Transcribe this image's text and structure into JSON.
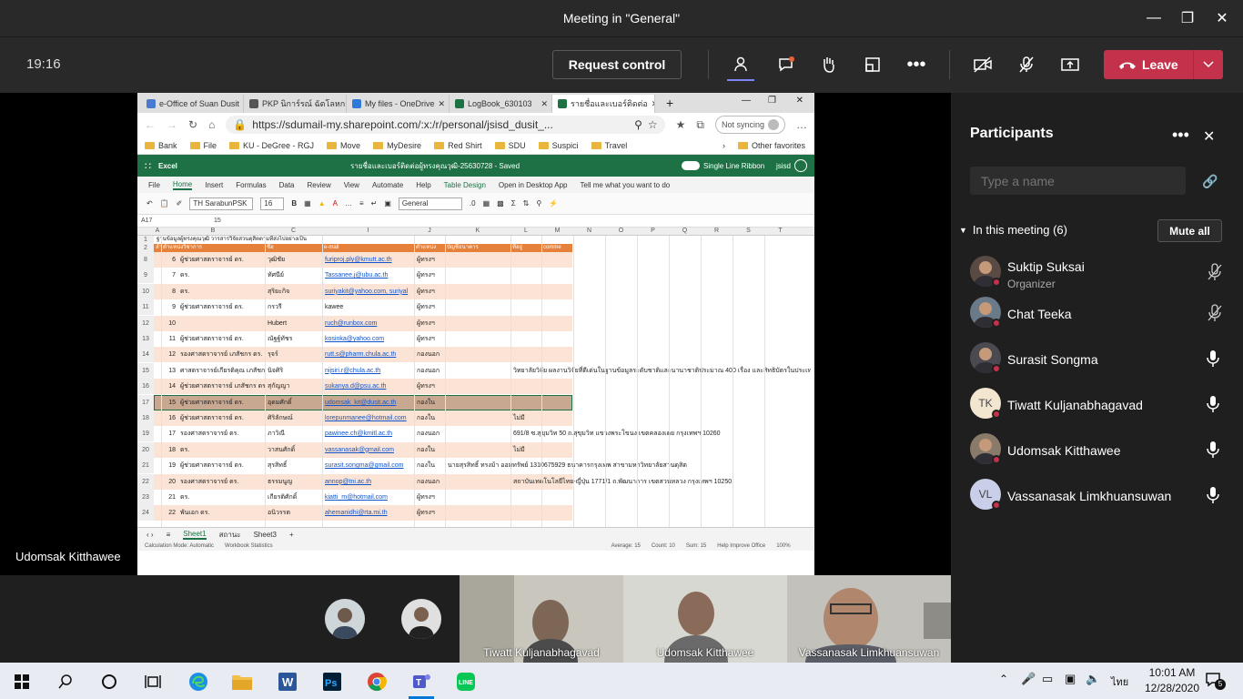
{
  "window": {
    "title": "Meeting in \"General\""
  },
  "toolbar": {
    "time": "19:16",
    "request_control": "Request control",
    "leave": "Leave"
  },
  "stage": {
    "presenter_name": "Udomsak Kitthawee"
  },
  "browser": {
    "tabs": [
      {
        "label": "e-Office of Suan Dusit",
        "color": "#4a7bd0"
      },
      {
        "label": "PKP นิการ์รณ์ ฉัตโลหกร",
        "color": "#555555"
      },
      {
        "label": "My files - OneDrive",
        "color": "#2f7ad8"
      },
      {
        "label": "LogBook_630103",
        "color": "#1e7145"
      },
      {
        "label": "รายชื่อและเบอร์ติดต่อ",
        "color": "#1e7145"
      }
    ],
    "url": "https://sdumail-my.sharepoint.com/:x:/r/personal/jsisd_dusit_...",
    "sync_label": "Not syncing",
    "favorites": [
      "Bank",
      "File",
      "KU - DeGree - RGJ",
      "Move",
      "MyDesire",
      "Red Shirt",
      "SDU",
      "Suspici",
      "Travel"
    ],
    "other_favorites": "Other favorites",
    "excel": {
      "app": "Excel",
      "doc_title": "รายชื่อและเบอร์ติดต่อผู้ทรงคุณวุฒิ-25630728 - Saved",
      "single_line": "Single Line Ribbon",
      "user": "jsisd",
      "ribbon_tabs": [
        "File",
        "Home",
        "Insert",
        "Formulas",
        "Data",
        "Review",
        "View",
        "Automate",
        "Help",
        "Table Design",
        "Open in Desktop App",
        "Tell me what you want to do"
      ],
      "font": "TH SarabunPSK",
      "font_size": "16",
      "number_format": "General",
      "cell_ref": "A17",
      "formula": "15",
      "columns": [
        "A",
        "B",
        "C",
        "I",
        "J",
        "K",
        "L",
        "M",
        "N",
        "O",
        "P",
        "Q",
        "R",
        "S",
        "T"
      ],
      "title_row": "ฐานข้อมูลผู้ทรงคุณวุฒิ วารสารวิจัยสวนดุสิตตามที่ส่งไปอย่างเป็น",
      "headers": [
        "ลำ",
        "ตำแหน่งวิชาการ",
        "ชื่อ",
        "e-mail",
        "ตำแหน่ง",
        "บัญชีธนาคาร",
        "ที่อยู่",
        "comme"
      ],
      "rows": [
        {
          "num": "8",
          "no": "6",
          "title": "ผู้ช่วยศาสตราจารย์ ดร.",
          "name": "วุฒิชัย",
          "email": "furiproj.ply@kmutt.ac.th",
          "pos": "ผู้ทรงฯ",
          "bank": "",
          "addr": ""
        },
        {
          "num": "9",
          "no": "7",
          "title": "ดร.",
          "name": "ทัศนีย์",
          "email": "Tassanee.j@ubu.ac.th",
          "pos": "ผู้ทรงฯ",
          "bank": "",
          "addr": ""
        },
        {
          "num": "10",
          "no": "8",
          "title": "ดร.",
          "name": "สุริยะกิจ",
          "email": "suriyakit@yahoo.com, suriyal",
          "pos": "ผู้ทรงฯ",
          "bank": "",
          "addr": ""
        },
        {
          "num": "11",
          "no": "9",
          "title": "ผู้ช่วยศาสตราจารย์ ดร.",
          "name": "กรวรี",
          "email": "kawee",
          "pos": "ผู้ทรงฯ",
          "bank": "",
          "addr": ""
        },
        {
          "num": "12",
          "no": "10",
          "title": "",
          "name": "Hubert",
          "email": "ruch@runbox.com",
          "pos": "ผู้ทรงฯ",
          "bank": "",
          "addr": ""
        },
        {
          "num": "13",
          "no": "11",
          "title": "ผู้ช่วยศาสตราจารย์ ดร.",
          "name": "ณัฐฐ์ทัชร",
          "email": "kosinka@yahoo.com",
          "pos": "ผู้ทรงฯ",
          "bank": "",
          "addr": ""
        },
        {
          "num": "14",
          "no": "12",
          "title": "รองศาสตราจารย์ เภสัชกร ดร.",
          "name": "รุจร์",
          "email": "rutt.s@pharm.chula.ac.th",
          "pos": "กองนอก",
          "bank": "",
          "addr": ""
        },
        {
          "num": "15",
          "no": "13",
          "title": "ศาสตราจารย์เกียรติคุณ เภสัชกร ดร.",
          "name": "นิจศิริ",
          "email": "nijsiri.r@chula.ac.th",
          "pos": "กองนอก",
          "bank": "",
          "addr": "วิทยาลัยวิจัย ผลงานวิจัยที่ดีเด่นในฐานข้อมูลระดับชาติและนานาชาติประมาณ 400 เรื่อง และสิทธิบัตรในประเท"
        },
        {
          "num": "16",
          "no": "14",
          "title": "ผู้ช่วยศาสตราจารย์ เภสัชกร ดร.",
          "name": "สุกัญญา",
          "email": "sukanya.d@psu.ac.th",
          "pos": "ผู้ทรงฯ",
          "bank": "",
          "addr": ""
        },
        {
          "num": "17",
          "no": "15",
          "title": "ผู้ช่วยศาสตราจารย์ ดร.",
          "name": "อุดมศักดิ์",
          "email": "udomsak_kit@dusit.ac.th",
          "pos": "กองใน",
          "bank": "",
          "addr": ""
        },
        {
          "num": "18",
          "no": "16",
          "title": "ผู้ช่วยศาสตราจารย์ ดร.",
          "name": "ศิริลักษณ์",
          "email": "lorepunmanee@hotmail.com",
          "pos": "กองใน",
          "bank": "",
          "addr": "ไม่มี"
        },
        {
          "num": "19",
          "no": "17",
          "title": "รองศาสตราจารย์ ดร.",
          "name": "ภาวิณี",
          "email": "pawinee.ch@kmitl.ac.th",
          "pos": "กองนอก",
          "bank": "",
          "addr": "691/8 ซ.สุขุมวิท 50 ถ.สุขุมวิท แขวงพระโขนง เขตคลองเตย กรุงเทพฯ 10260"
        },
        {
          "num": "20",
          "no": "18",
          "title": "ดร.",
          "name": "วาสนศักดิ์",
          "email": "vassanasak@gmail.com",
          "pos": "กองใน",
          "bank": "",
          "addr": "ไม่มี"
        },
        {
          "num": "21",
          "no": "19",
          "title": "ผู้ช่วยศาสตราจารย์ ดร.",
          "name": "สุรสิทธิ์",
          "email": "surasit.songma@gmail.com",
          "pos": "กองใน",
          "bank": "นายสุรสิทธิ์ ทรงม้า ออมทรัพย์ 1310675929 ธนาคารกรุงเทพ สาขามหาวิทยาลัยสวนดุสิต",
          "addr": ""
        },
        {
          "num": "22",
          "no": "20",
          "title": "รองศาสตราจารย์ ดร.",
          "name": "ธรรมนูญ",
          "email": "annop@tni.ac.th",
          "pos": "กองนอก",
          "bank": "",
          "addr": "สถาบันเทคโนโลยีไทย-ญี่ปุ่น 1771/1 ถ.พัฒนาการ เขตสวนหลวง กรุงเทพฯ 10250"
        },
        {
          "num": "23",
          "no": "21",
          "title": "ดร.",
          "name": "เกียรติศักดิ์",
          "email": "kiatti_m@hotmail.com",
          "pos": "ผู้ทรงฯ",
          "bank": "",
          "addr": ""
        },
        {
          "num": "24",
          "no": "22",
          "title": "พันเอก ดร.",
          "name": "อนิวรรต",
          "email": "ahemanidhi@rta.mi.th",
          "pos": "ผู้ทรงฯ",
          "bank": "",
          "addr": ""
        }
      ],
      "sheets": [
        "Sheet1",
        "สถานะ",
        "Sheet3"
      ],
      "status": {
        "mode": "Calculation Mode: Automatic",
        "stats": "Workbook Statistics",
        "average": "Average: 15",
        "count": "Count: 10",
        "sum": "Sum: 15",
        "help": "Help Improve Office",
        "zoom": "100%"
      }
    }
  },
  "participants": {
    "title": "Participants",
    "search_placeholder": "Type a name",
    "in_meeting": "In this meeting (6)",
    "mute_all": "Mute all",
    "people": [
      {
        "name": "Suktip Suksai",
        "role": "Organizer",
        "initials": "",
        "mic": "muted",
        "avatar_color": "#5a4a44"
      },
      {
        "name": "Chat Teeka",
        "role": "",
        "initials": "",
        "mic": "muted",
        "avatar_color": "#6a7a88"
      },
      {
        "name": "Surasit Songma",
        "role": "",
        "initials": "",
        "mic": "on",
        "avatar_color": "#4a4a50"
      },
      {
        "name": "Tiwatt Kuljanabhagavad",
        "role": "",
        "initials": "TK",
        "mic": "on",
        "avatar_color": "#f2e6d0"
      },
      {
        "name": "Udomsak Kitthawee",
        "role": "",
        "initials": "",
        "mic": "on",
        "avatar_color": "#8a7a6a"
      },
      {
        "name": "Vassanasak Limkhuansuwan",
        "role": "",
        "initials": "VL",
        "mic": "on",
        "avatar_color": "#c9cfe8"
      }
    ]
  },
  "videos": [
    {
      "name": "Tiwatt Kuljanabhagavad"
    },
    {
      "name": "Udomsak Kitthawee"
    },
    {
      "name": "Vassanasak Limkhuansuwan"
    }
  ],
  "taskbar": {
    "time": "10:01 AM",
    "date": "12/28/2020",
    "lang": "ไทย",
    "notif": "5"
  }
}
